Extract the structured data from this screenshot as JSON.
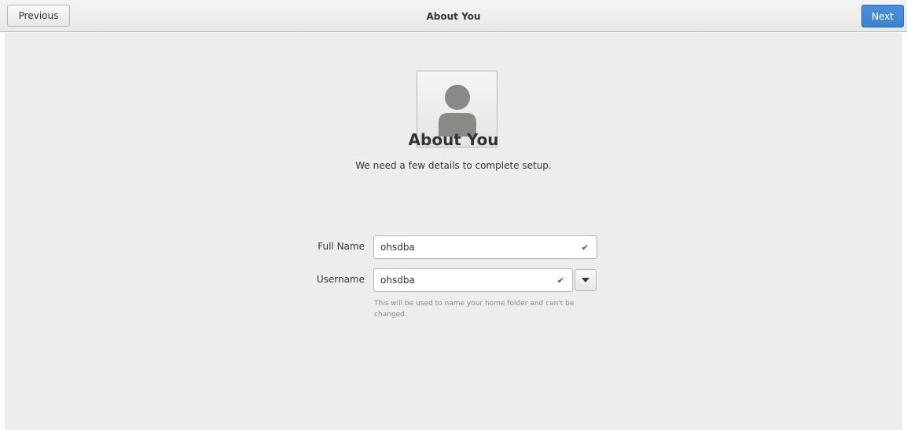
{
  "header": {
    "previous_label": "Previous",
    "title": "About You",
    "next_label": "Next"
  },
  "avatar": {
    "icon": "avatar-default-icon"
  },
  "main": {
    "title": "About You",
    "subtitle": "We need a few details to complete setup."
  },
  "form": {
    "full_name": {
      "label": "Full Name",
      "value": "ohsdba",
      "valid_icon": "checkmark-icon"
    },
    "username": {
      "label": "Username",
      "value": "ohsdba",
      "valid_icon": "checkmark-icon",
      "dropdown_icon": "chevron-down-icon",
      "hint": "This will be used to name your home folder and can't be changed."
    }
  },
  "colors": {
    "accent": "#4a90d9",
    "background": "#ededed"
  }
}
